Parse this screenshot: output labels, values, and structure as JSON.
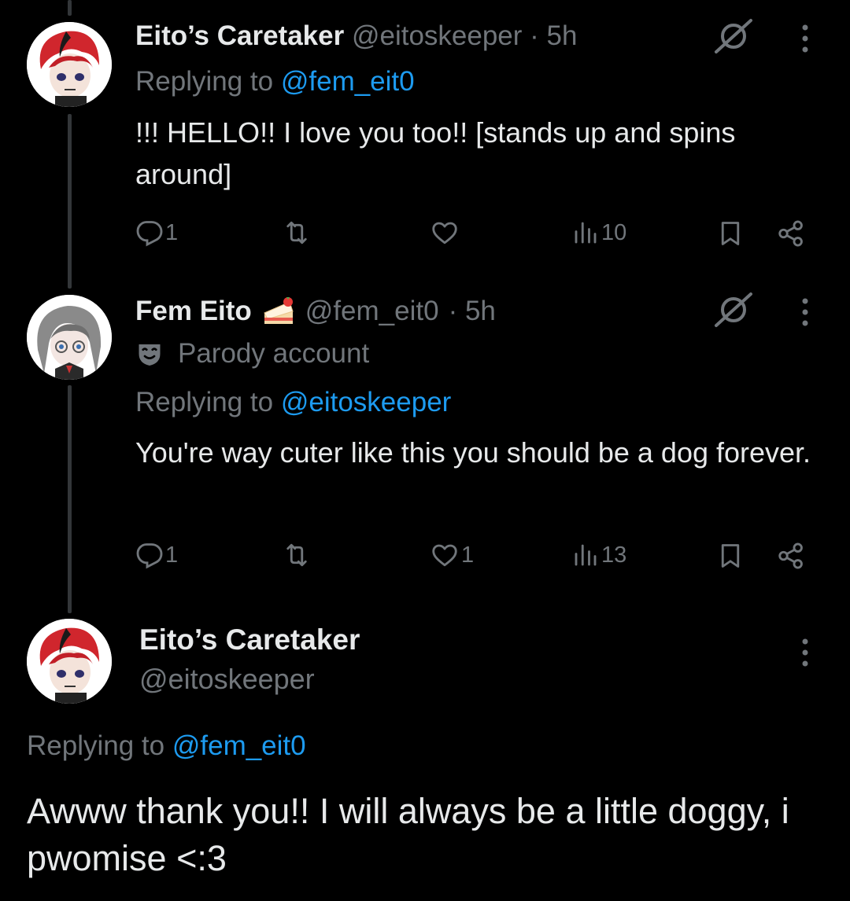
{
  "tweets": [
    {
      "display_name": "Eito’s Caretaker",
      "handle": "@eitoskeeper",
      "time": "· 5h",
      "replying_prefix": "Replying to",
      "replying_to": "@fem_eit0",
      "text": "!!! HELLO!! I love you too!! [stands up and spins around]",
      "replies": "1",
      "reposts": "",
      "likes": "",
      "views": "10"
    },
    {
      "display_name": "Fem Eito",
      "handle": "@fem_eit0",
      "time": "· 5h",
      "label": "Parody account",
      "replying_prefix": "Replying to",
      "replying_to": "@eitoskeeper",
      "text": "You're way cuter like this you should be a dog forever.",
      "replies": "1",
      "reposts": "",
      "likes": "1",
      "views": "13"
    }
  ],
  "focused": {
    "display_name": "Eito’s Caretaker",
    "handle": "@eitoskeeper",
    "replying_prefix": "Replying to",
    "replying_to": "@fem_eit0",
    "text": "Awww thank you!! I will always be a little doggy, i pwomise <:3"
  },
  "colors": {
    "background": "#000000",
    "text": "#e7e9ea",
    "muted": "#71767b",
    "link": "#1d9bf0",
    "thread_line": "#333639"
  },
  "icons": [
    "reply-icon",
    "repost-icon",
    "like-icon",
    "views-icon",
    "bookmark-icon",
    "share-icon",
    "grok-icon",
    "more-icon",
    "cake-emoji",
    "parody-mask-icon"
  ]
}
